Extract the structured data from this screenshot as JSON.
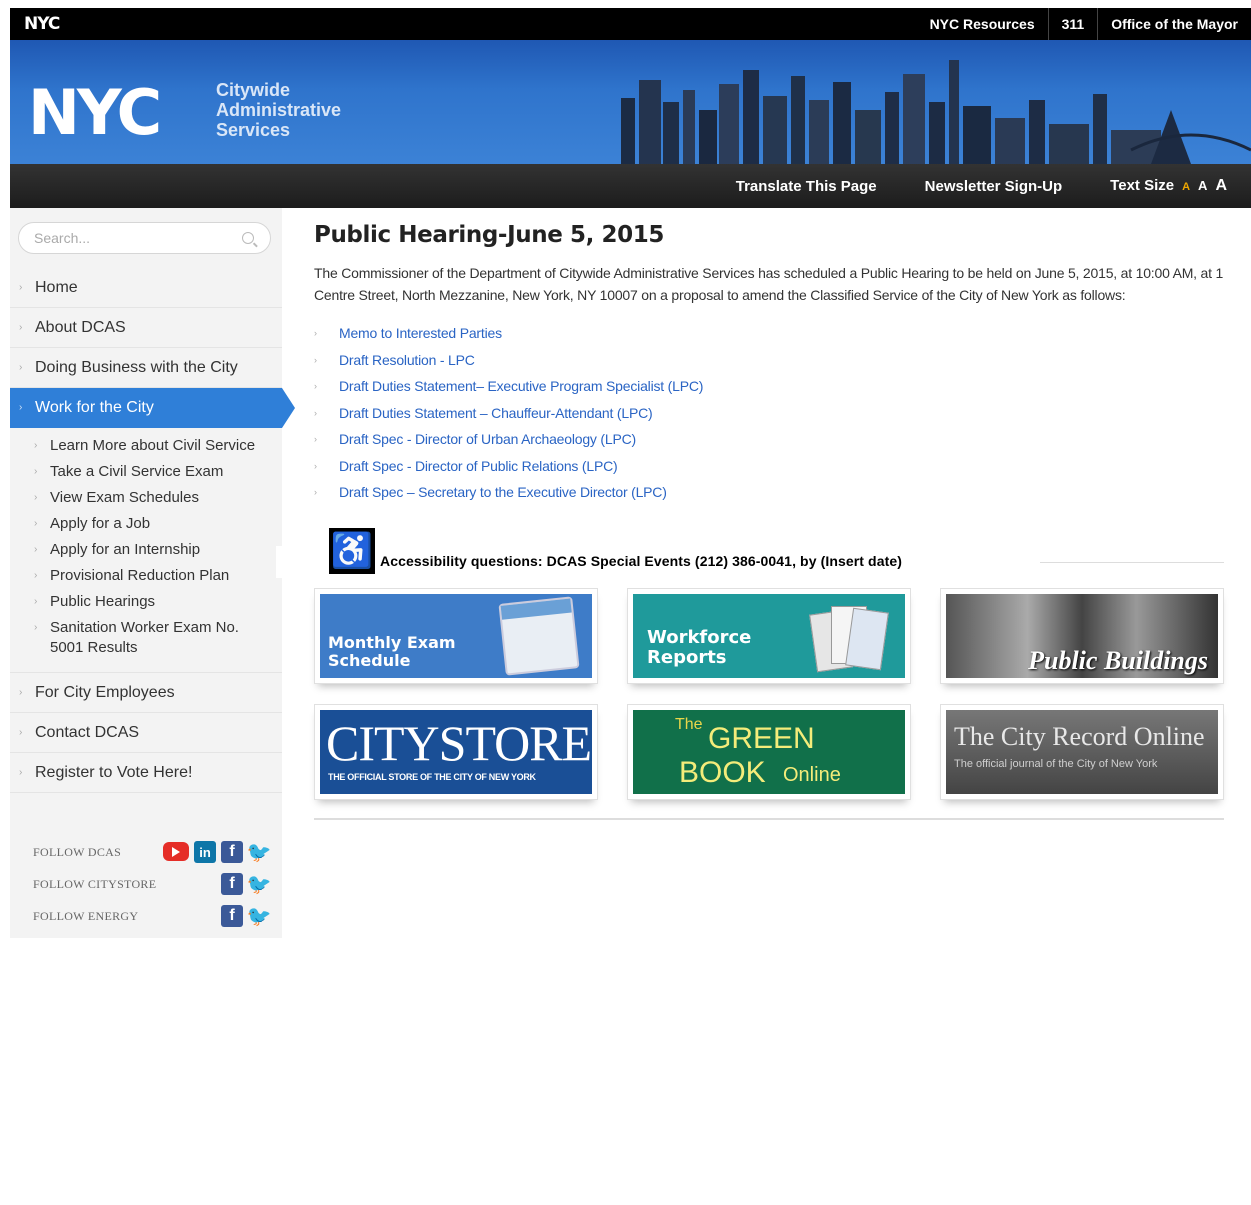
{
  "topbar": {
    "logo": "NYC",
    "links": [
      "NYC Resources",
      "311",
      "Office of the Mayor"
    ]
  },
  "header": {
    "logo": "NYC",
    "agency_lines": [
      "Citywide",
      "Administrative",
      "Services"
    ]
  },
  "subnav": {
    "translate": "Translate This Page",
    "newsletter": "Newsletter Sign-Up",
    "text_size_label": "Text Size",
    "text_size_options": [
      "A",
      "A",
      "A"
    ]
  },
  "search": {
    "placeholder": "Search..."
  },
  "sidebar": {
    "items": [
      {
        "label": "Home"
      },
      {
        "label": "About DCAS"
      },
      {
        "label": "Doing Business with the City"
      },
      {
        "label": "Work for the City"
      }
    ],
    "subitems": [
      "Learn More about Civil Service",
      "Take a Civil Service Exam",
      "View Exam Schedules",
      "Apply for a Job",
      "Apply for an Internship",
      "Provisional Reduction Plan",
      "Public Hearings",
      "Sanitation Worker Exam No. 5001 Results"
    ],
    "items_after": [
      {
        "label": "For City Employees"
      },
      {
        "label": "Contact DCAS"
      },
      {
        "label": "Register to Vote Here!"
      }
    ],
    "follow": [
      {
        "label": "FOLLOW DCAS"
      },
      {
        "label": "FOLLOW CITYSTORE"
      },
      {
        "label": "FOLLOW ENERGY"
      }
    ]
  },
  "main": {
    "title": "Public Hearing-June 5, 2015",
    "intro": "The Commissioner of the Department of Citywide Administrative Services has scheduled a Public Hearing to be held on June 5, 2015, at 10:00 AM, at 1 Centre Street, North Mezzanine, New York, NY 10007 on a proposal to amend the Classified Service of the City of New York as follows:",
    "links": [
      "Memo to Interested Parties",
      "Draft Resolution - LPC",
      "Draft Duties Statement– Executive Program Specialist (LPC)",
      "Draft Duties Statement – Chauffeur-Attendant (LPC)",
      "Draft Spec - Director of Urban Archaeology (LPC)",
      "Draft Spec - Director of Public Relations (LPC)",
      "Draft Spec – Secretary to the Executive Director (LPC)"
    ],
    "accessibility": "Accessibility questions: DCAS Special Events (212) 386-0041, by (Insert date)"
  },
  "tiles": {
    "exam_line1": "Monthly Exam",
    "exam_line2": "Schedule",
    "workforce_line1": "Workforce",
    "workforce_line2": "Reports",
    "buildings": "Public Buildings",
    "citystore": "CITYSTORE",
    "citystore_sub": "THE OFFICIAL STORE OF THE CITY OF NEW YORK",
    "greenbook_the": "The",
    "greenbook_green": "GREEN",
    "greenbook_book": "BOOK",
    "greenbook_online": "Online",
    "record_title": "The City Record Online",
    "record_sub": "The official journal of the City of New York"
  }
}
